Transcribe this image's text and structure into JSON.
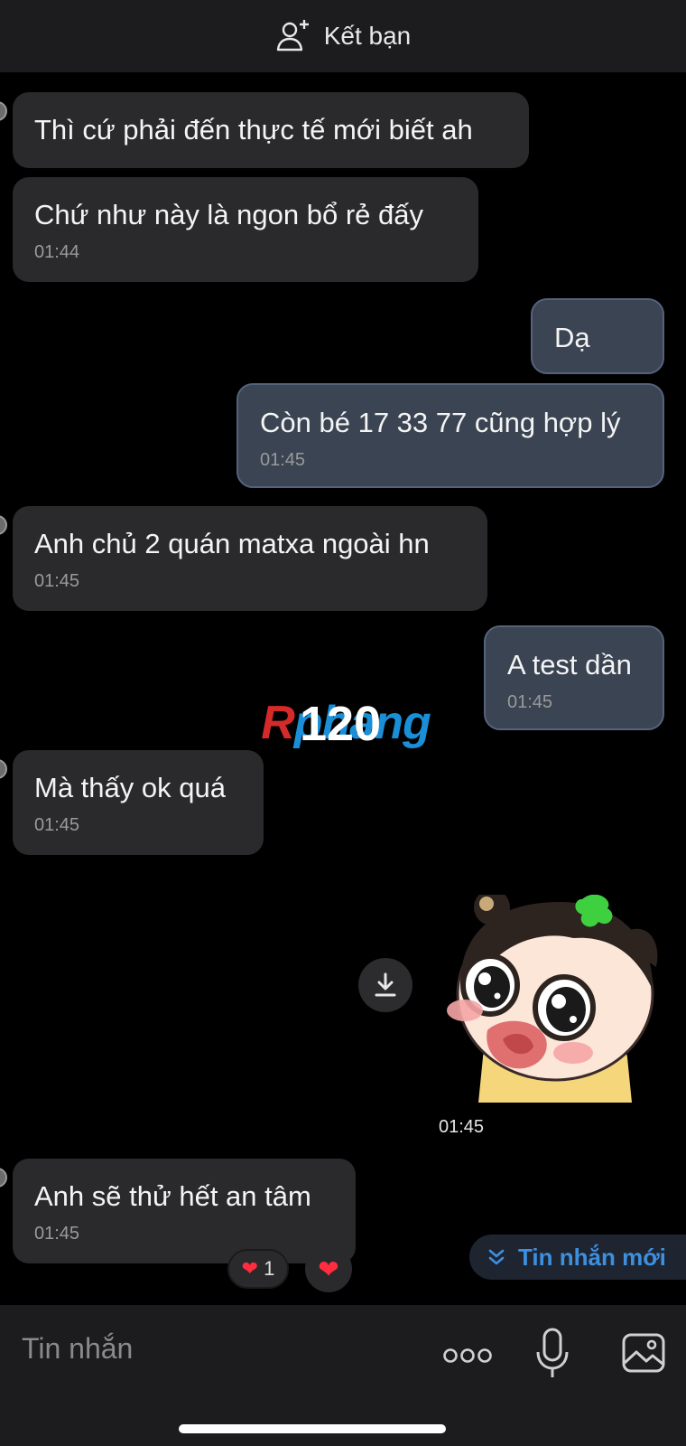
{
  "header": {
    "add_friend_label": "Kết bạn",
    "icon": "add-user-icon"
  },
  "messages": [
    {
      "dir": "in",
      "text": "Thì cứ phải đến thực tế mới biết ah",
      "time": ""
    },
    {
      "dir": "in",
      "text": "Chứ như này là ngon  bổ rẻ đấy",
      "time": "01:44"
    },
    {
      "dir": "out",
      "text": "Dạ",
      "time": ""
    },
    {
      "dir": "out",
      "text": "Còn bé 17 33 77 cũng hợp lý",
      "time": "01:45"
    },
    {
      "dir": "in",
      "text": "Anh chủ 2 quán matxa ngoài hn",
      "time": "01:45"
    },
    {
      "dir": "out",
      "text": "A test dần",
      "time": "01:45"
    },
    {
      "dir": "in",
      "text": "Mà thấy ok quá",
      "time": "01:45"
    },
    {
      "dir": "in",
      "text": "Anh sẽ thử hết an tâm",
      "time": "01:45"
    }
  ],
  "watermark": {
    "brand_r": "R",
    "brand_rest": "phang",
    "number": "120"
  },
  "sticker": {
    "time": "01:45",
    "icon": "sticker-crying-girl",
    "download_icon": "download-icon"
  },
  "reactions": {
    "heart_glyph": "❤",
    "count": "1"
  },
  "new_message": {
    "label": "Tin nhắn mới",
    "icon": "chevron-double-down-icon"
  },
  "composer": {
    "placeholder": "Tin nhắn"
  },
  "colors": {
    "background": "#000000",
    "incoming_bubble": "#2a2a2c",
    "outgoing_bubble": "#3a4452",
    "accent": "#3d8fe0",
    "heart": "#ff2d3d"
  }
}
